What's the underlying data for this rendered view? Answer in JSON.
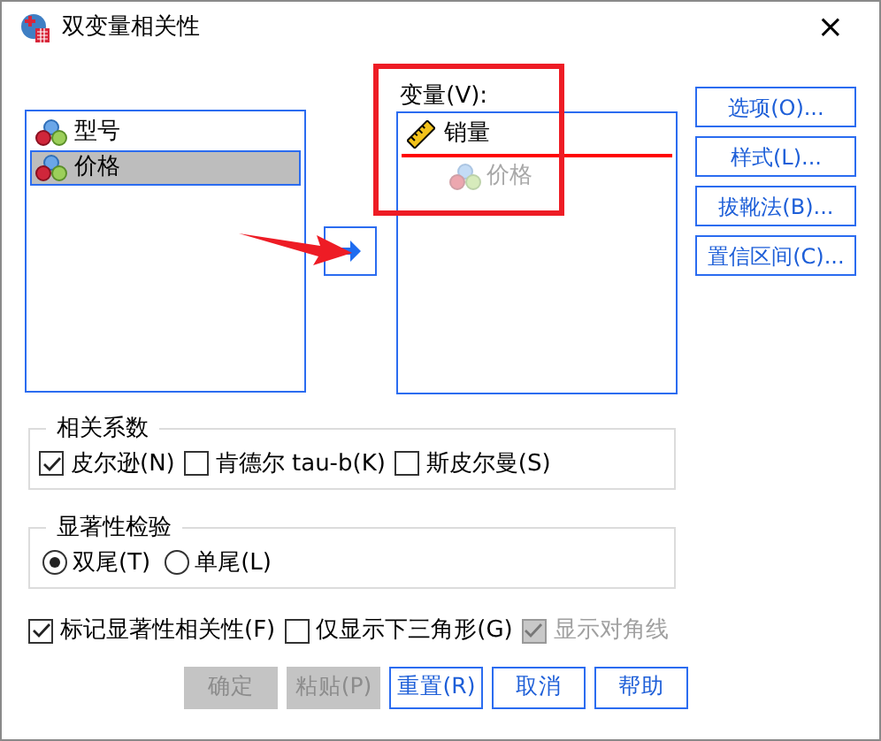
{
  "window": {
    "title": "双变量相关性",
    "close": "×"
  },
  "source_list": {
    "items": [
      {
        "label": "型号",
        "selected": false
      },
      {
        "label": "价格",
        "selected": true
      }
    ]
  },
  "move_button": {
    "kind": "right"
  },
  "target": {
    "label": "变量(V):",
    "items": [
      {
        "label": "销量"
      }
    ],
    "drag_preview": {
      "label": "价格"
    }
  },
  "side_buttons": [
    "选项(O)...",
    "样式(L)...",
    "拔靴法(B)...",
    "置信区间(C)..."
  ],
  "coefficients": {
    "title": "相关系数",
    "options": [
      {
        "label": "皮尔逊(N)",
        "checked": true
      },
      {
        "label": "肯德尔 tau-b(K)",
        "checked": false
      },
      {
        "label": "斯皮尔曼(S)",
        "checked": false
      }
    ]
  },
  "significance": {
    "title": "显著性检验",
    "options": [
      {
        "label": "双尾(T)",
        "selected": true
      },
      {
        "label": "单尾(L)",
        "selected": false
      }
    ]
  },
  "flags": [
    {
      "label": "标记显著性相关性(F)",
      "checked": true,
      "disabled": false
    },
    {
      "label": "仅显示下三角形(G)",
      "checked": false,
      "disabled": false
    },
    {
      "label": "显示对角线",
      "checked": true,
      "disabled": true
    }
  ],
  "buttons": [
    {
      "label": "确定",
      "disabled": true
    },
    {
      "label": "粘贴(P)",
      "disabled": true
    },
    {
      "label": "重置(R)",
      "disabled": false
    },
    {
      "label": "取消",
      "disabled": false
    },
    {
      "label": "帮助",
      "disabled": false
    }
  ],
  "annotations": {
    "highlight_box": true,
    "pointer_arrow": true
  }
}
